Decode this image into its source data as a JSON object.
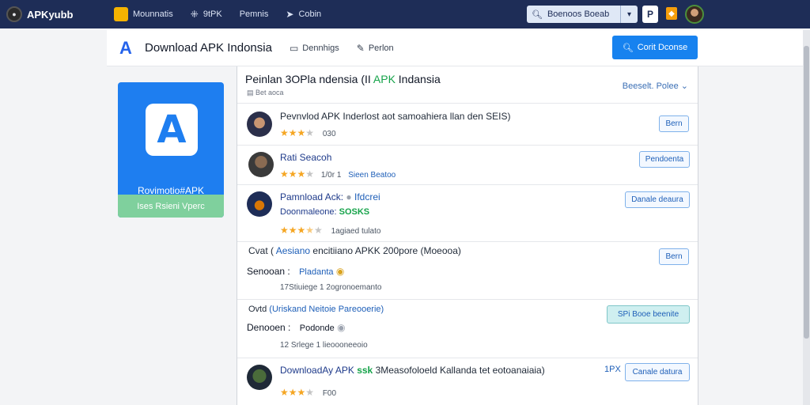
{
  "topbar": {
    "brand": "APKyubb",
    "nav": [
      {
        "label": "Mounnatis"
      },
      {
        "label": "9tPK"
      },
      {
        "label": "Pemnis"
      },
      {
        "label": "Cobin"
      }
    ],
    "search_placeholder": "Boenoos Boeab"
  },
  "header": {
    "title": "Download APK Indonsia",
    "link1": "Dennhigs",
    "link2": "Perlon",
    "button": "Corit Dconse"
  },
  "sidecard": {
    "name": "Rovimotio#APK",
    "bar_label": "Ises Rsieni Vperc"
  },
  "panel": {
    "title_prefix": "Peinlan 3OPla ndensia (II",
    "title_green": "APK",
    "title_suffix": "Indansia",
    "subtitle": "Bet aoca",
    "sort_label": "Beeselt. Polee"
  },
  "rows": [
    {
      "title": "Pevnvlod APK Inderlost aot samoahiera llan den SEIS)",
      "rating": 3,
      "meta": "030",
      "button": "Bern"
    },
    {
      "title": "Rati Seacoh",
      "rating": 3,
      "meta1": "1/0r 1",
      "meta2": "Sieen Beatoo",
      "button": "Pendoenta"
    },
    {
      "title": "Pamnload Ack:",
      "title_link": "Ifdcrei",
      "meta_label": "Doonmaleone:",
      "meta_value": "SOSKS",
      "rating": 3.5,
      "meta": "1agiaed tulato",
      "button": "Danale deaura"
    },
    {
      "title_prefix": "Cvat (",
      "title_link": "Aesiano",
      "title_rest": "encitiiano APKK 200pore (Moeooa)",
      "label": "Senooan :",
      "value": "Pladanta",
      "meta": "17Stiuiege 1 2ogronoemanto",
      "button": "Bern"
    },
    {
      "title_prefix": "Ovtd",
      "title_link": "(Uriskand Neitoie Pareooerie)",
      "label": "Denooen :",
      "value": "Podonde",
      "meta": "12 Srlege 1 lieoooneeoio",
      "button": "SPi Booe beenite"
    },
    {
      "title": "DownloadAy APK",
      "title_green": "ssk",
      "title_rest": "3Measofoloeld Kallanda tet eotoanaiaia)",
      "rating": 3,
      "meta": "F00",
      "tag": "1PX",
      "button": "Canale datura"
    }
  ]
}
